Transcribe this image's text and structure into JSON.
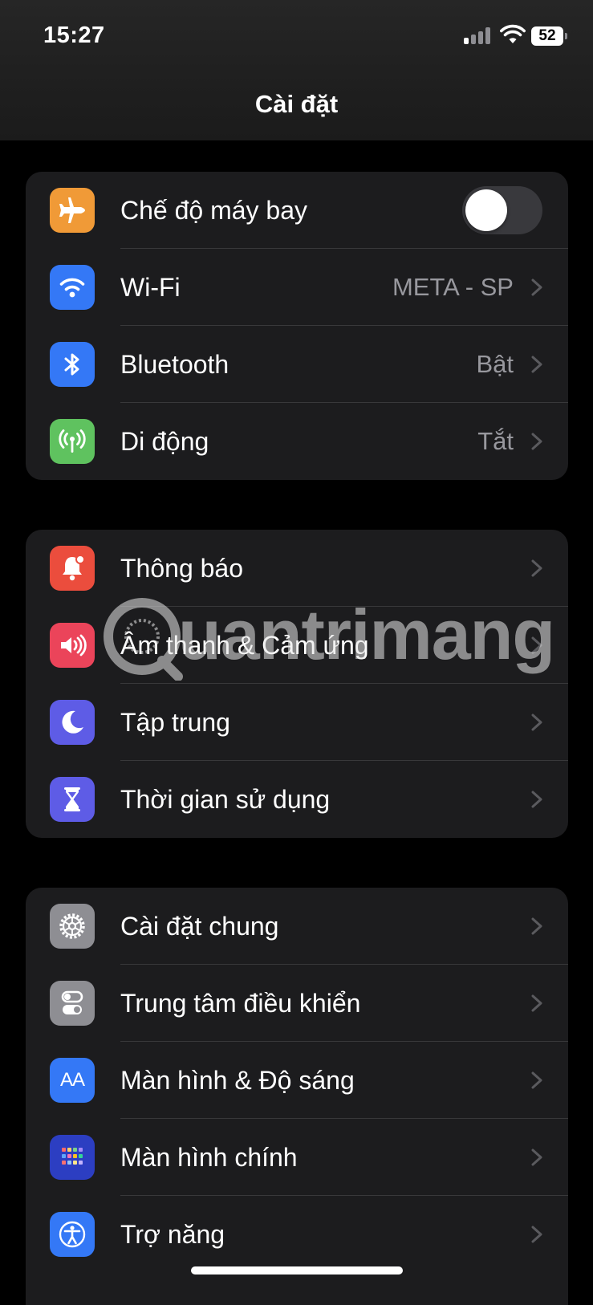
{
  "status_bar": {
    "time": "15:27",
    "battery": "52",
    "cellular_icon": "cellular-signal-icon",
    "wifi_icon": "wifi-status-icon"
  },
  "header": {
    "title": "Cài đặt"
  },
  "groups": [
    {
      "rows": [
        {
          "label": "Chế độ máy bay",
          "icon": "airplane-icon",
          "icon_color": "#f09a37",
          "toggle": false
        },
        {
          "label": "Wi-Fi",
          "value": "META - SP",
          "icon": "wifi-icon",
          "icon_color": "#3478f6"
        },
        {
          "label": "Bluetooth",
          "value": "Bật",
          "icon": "bluetooth-icon",
          "icon_color": "#3478f6"
        },
        {
          "label": "Di động",
          "value": "Tắt",
          "icon": "antenna-icon",
          "icon_color": "#5fc25f"
        }
      ]
    },
    {
      "rows": [
        {
          "label": "Thông báo",
          "icon": "bell-icon",
          "icon_color": "#eb4d3d"
        },
        {
          "label": "Âm thanh & Cảm ứng",
          "icon": "speaker-icon",
          "icon_color": "#eb445a"
        },
        {
          "label": "Tập trung",
          "icon": "moon-icon",
          "icon_color": "#5e5ce6"
        },
        {
          "label": "Thời gian sử dụng",
          "icon": "hourglass-icon",
          "icon_color": "#5e5ce6"
        }
      ]
    },
    {
      "rows": [
        {
          "label": "Cài đặt chung",
          "icon": "gear-icon",
          "icon_color": "#8e8e93"
        },
        {
          "label": "Trung tâm điều khiển",
          "icon": "switches-icon",
          "icon_color": "#8e8e93"
        },
        {
          "label": "Màn hình & Độ sáng",
          "icon": "text-size-icon",
          "icon_color": "#3478f6",
          "icon_text": "AA"
        },
        {
          "label": "Màn hình chính",
          "icon": "home-screen-icon",
          "icon_color": "#2c3ec2"
        },
        {
          "label": "Trợ năng",
          "icon": "accessibility-icon",
          "icon_color": "#3478f6"
        }
      ]
    }
  ],
  "watermark": {
    "text": "uantrimang"
  }
}
